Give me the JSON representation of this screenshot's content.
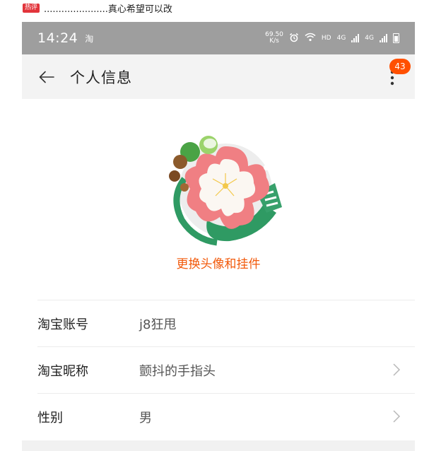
{
  "comment": {
    "badge": "热评",
    "text": "......................真心希望可以改"
  },
  "status_bar": {
    "time": "14:24",
    "app_icon": "淘",
    "net_speed_value": "69.50",
    "net_speed_unit": "K/s",
    "hd_label": "HD",
    "network": "4G",
    "network2": "4G"
  },
  "nav": {
    "title": "个人信息",
    "badge_count": "43"
  },
  "profile": {
    "change_avatar_label": "更换头像和挂件"
  },
  "info_rows": [
    {
      "label": "淘宝账号",
      "value": "j8狂甩"
    },
    {
      "label": "淘宝昵称",
      "value": "颤抖的手指头"
    },
    {
      "label": "性别",
      "value": "男"
    }
  ],
  "colors": {
    "accent": "#f2590a",
    "badge": "#ff5000",
    "status_bar": "#9e9e9e",
    "nav_bg": "#f3f3f3"
  }
}
